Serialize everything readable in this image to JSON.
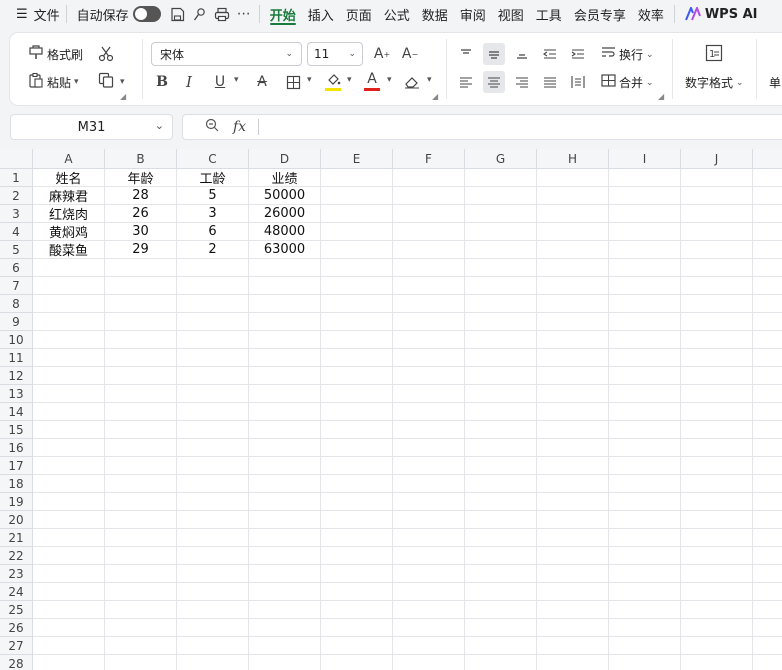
{
  "menubar": {
    "file_label": "文件",
    "autosave_label": "自动保存",
    "tabs": [
      "开始",
      "插入",
      "页面",
      "公式",
      "数据",
      "审阅",
      "视图",
      "工具",
      "会员专享",
      "效率"
    ],
    "active_tab": "开始",
    "wps_ai_label": "WPS AI"
  },
  "ribbon": {
    "format_painter": "格式刷",
    "paste": "粘贴",
    "font_name": "宋体",
    "font_size": "11",
    "wrap_text": "换行",
    "merge": "合并",
    "number_format": "数字格式",
    "cut_off_label": "单",
    "font_color": "#e0201b",
    "highlight_color": "#f5e400"
  },
  "formula_bar": {
    "name_box": "M31",
    "fx_label": "fx",
    "formula": ""
  },
  "sheet": {
    "columns": [
      "A",
      "B",
      "C",
      "D",
      "E",
      "F",
      "G",
      "H",
      "I",
      "J"
    ],
    "rows": [
      "1",
      "2",
      "3",
      "4",
      "5",
      "6",
      "7",
      "8",
      "9",
      "10",
      "11",
      "12",
      "13",
      "14",
      "15",
      "16",
      "17",
      "18",
      "19",
      "20",
      "21",
      "22",
      "23",
      "24",
      "25",
      "26",
      "27",
      "28"
    ],
    "cells": [
      [
        "姓名",
        "年龄",
        "工龄",
        "业绩"
      ],
      [
        "麻辣君",
        "28",
        "5",
        "50000"
      ],
      [
        "红烧肉",
        "26",
        "3",
        "26000"
      ],
      [
        "黄焖鸡",
        "30",
        "6",
        "48000"
      ],
      [
        "酸菜鱼",
        "29",
        "2",
        "63000"
      ]
    ]
  }
}
